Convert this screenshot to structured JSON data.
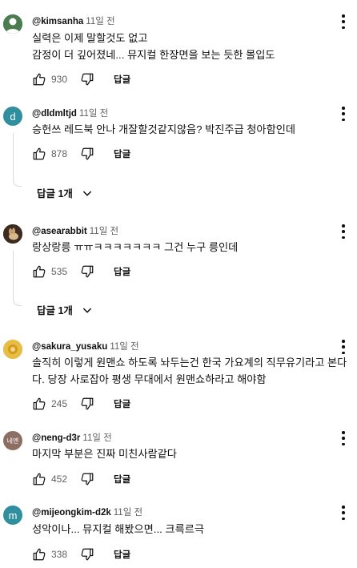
{
  "comments": [
    {
      "handle": "@kimsanha",
      "time": "11일 전",
      "lines": [
        "실력은 이제 말할것도 없고",
        "감정이 더 깊어졌네... 뮤지컬 한장면을 보는 듯한 몰입도"
      ],
      "likes": "930",
      "reply_label": "답글",
      "avatar": {
        "color": "#3a6b3e"
      }
    },
    {
      "handle": "@dldmltjd",
      "time": "11일 전",
      "lines": [
        "승헌쓰 레드북 안나 개잘할것같지않음? 박진주급 청아함인데"
      ],
      "likes": "878",
      "reply_label": "답글",
      "replies_label": "답글 1개",
      "avatar": {
        "letter": "d",
        "color": "#2f8f9d"
      }
    },
    {
      "handle": "@asearabbit",
      "time": "11일 전",
      "lines": [
        "랑상랑릉 ㅠㅠㅋㅋㅋㅋㅋㅋㅋ 그건 누구 릉인데"
      ],
      "likes": "535",
      "reply_label": "답글",
      "replies_label": "답글 1개",
      "avatar": {
        "color": "#3d2a20"
      }
    },
    {
      "handle": "@sakura_yusaku",
      "time": "11일 전",
      "lines": [
        "솔직히 이렇게 원맨쇼 하도록 놔두는건 한국 가요계의 직무유기라고 본다",
        "다. 당장 사로잡아 평생 무대에서 원맨쇼하라고 해야함"
      ],
      "likes": "245",
      "reply_label": "답글",
      "avatar": {
        "color": "#e2b53a"
      }
    },
    {
      "handle": "@neng-d3r",
      "time": "11일 전",
      "lines": [
        "마지막 부분은 진짜 미친사람같다"
      ],
      "likes": "452",
      "reply_label": "답글",
      "avatar": {
        "letter": "네엔",
        "color": "#8d6e63"
      }
    },
    {
      "handle": "@mijeongkim-d2k",
      "time": "11일 전",
      "lines": [
        "성악이나... 뮤지컬 해봤으면... 크륵르극"
      ],
      "likes": "338",
      "reply_label": "답글",
      "avatar": {
        "letter": "m",
        "color": "#2f8f9d"
      }
    }
  ],
  "icons": {
    "like": "thumb-up-icon",
    "dislike": "thumb-down-icon",
    "more": "more-vert-icon",
    "expand": "chevron-down-icon"
  }
}
